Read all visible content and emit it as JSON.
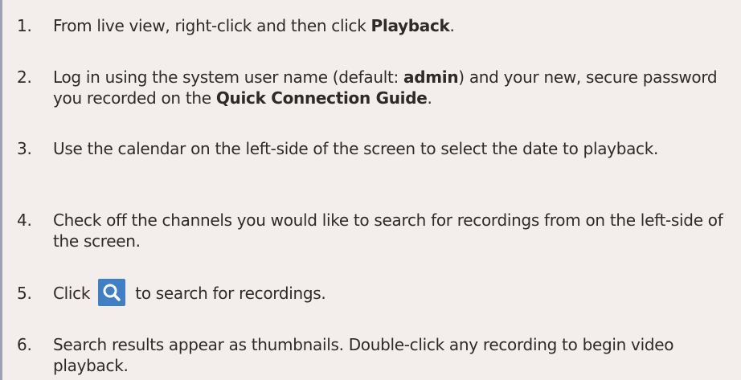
{
  "steps": [
    {
      "number": "1.",
      "text_before": "From live view, right-click and then click ",
      "bold_1": "Playback",
      "text_after": "."
    },
    {
      "number": "2.",
      "text_before": "Log in using the system user name (default: ",
      "bold_1": "admin",
      "text_middle": ") and your new, secure password you recorded on the ",
      "bold_2": "Quick Connection Guide",
      "text_after": "."
    },
    {
      "number": "3.",
      "text": "Use the calendar on the left-side of the screen to select the date to playback."
    },
    {
      "number": "4.",
      "text": "Check off the channels you would like to search for recordings from on the left-side of the screen."
    },
    {
      "number": "5.",
      "text_before": "Click ",
      "icon": "search-icon",
      "text_after": " to search for recordings.",
      "icon_color": "#3f7fc6"
    },
    {
      "number": "6.",
      "text": "Search results appear as thumbnails. Double-click any recording to begin video playback."
    }
  ]
}
